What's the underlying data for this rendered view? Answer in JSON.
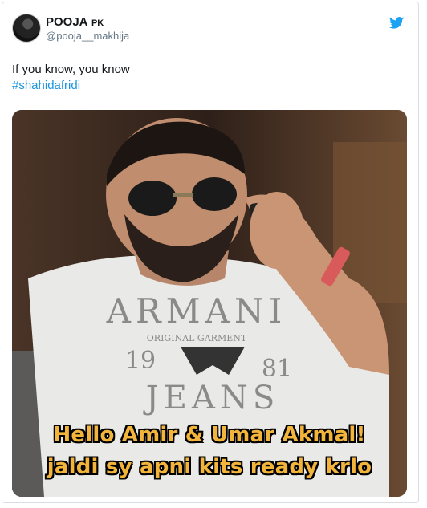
{
  "tweet": {
    "display_name": "POOJA",
    "name_suffix": "PK",
    "handle": "@pooja__makhija",
    "text_line1": "If you know, you know",
    "hashtag": "#shahidafridi",
    "brand_icon": "twitter-bird-icon",
    "accent_color": "#1b95e0"
  },
  "media": {
    "shirt_text_top": "ARMANI",
    "shirt_text_mid": "ORIGINAL GARMENT",
    "shirt_year_left": "19",
    "shirt_year_right": "81",
    "shirt_text_bottom": "JEANS",
    "caption_line1": "Hello Amir & Umar Akmal!",
    "caption_line2": "jaldi sy apni kits ready krlo",
    "caption_color": "#f2b43a"
  }
}
